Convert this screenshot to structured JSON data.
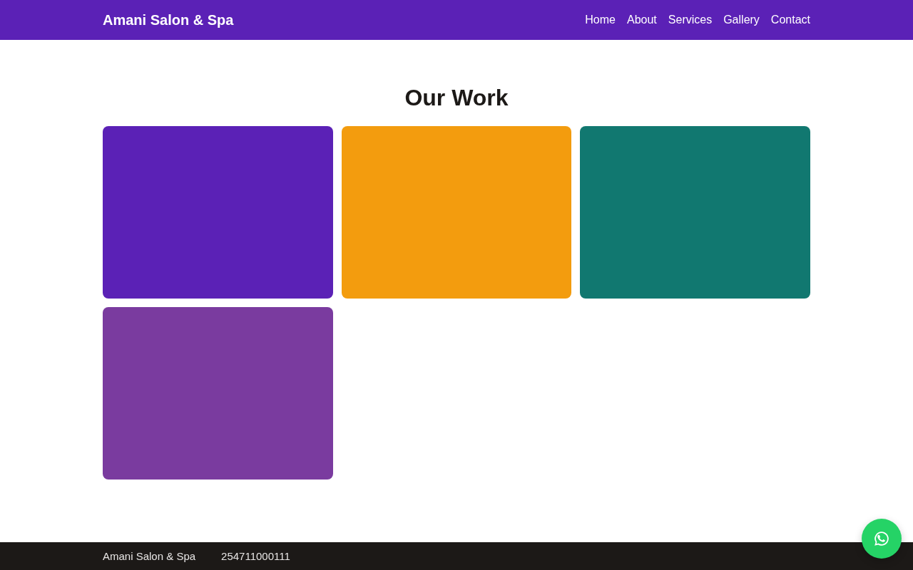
{
  "header": {
    "logo": "Amani Salon & Spa",
    "nav": [
      "Home",
      "About",
      "Services",
      "Gallery",
      "Contact"
    ]
  },
  "gallery": {
    "title": "Our Work",
    "items": [
      {
        "color": "#5b21b6"
      },
      {
        "color": "#f39c0e"
      },
      {
        "color": "#117870"
      },
      {
        "color": "#7a3b9f"
      }
    ]
  },
  "footer": {
    "name": "Amani Salon & Spa",
    "phone": "254711000111"
  }
}
